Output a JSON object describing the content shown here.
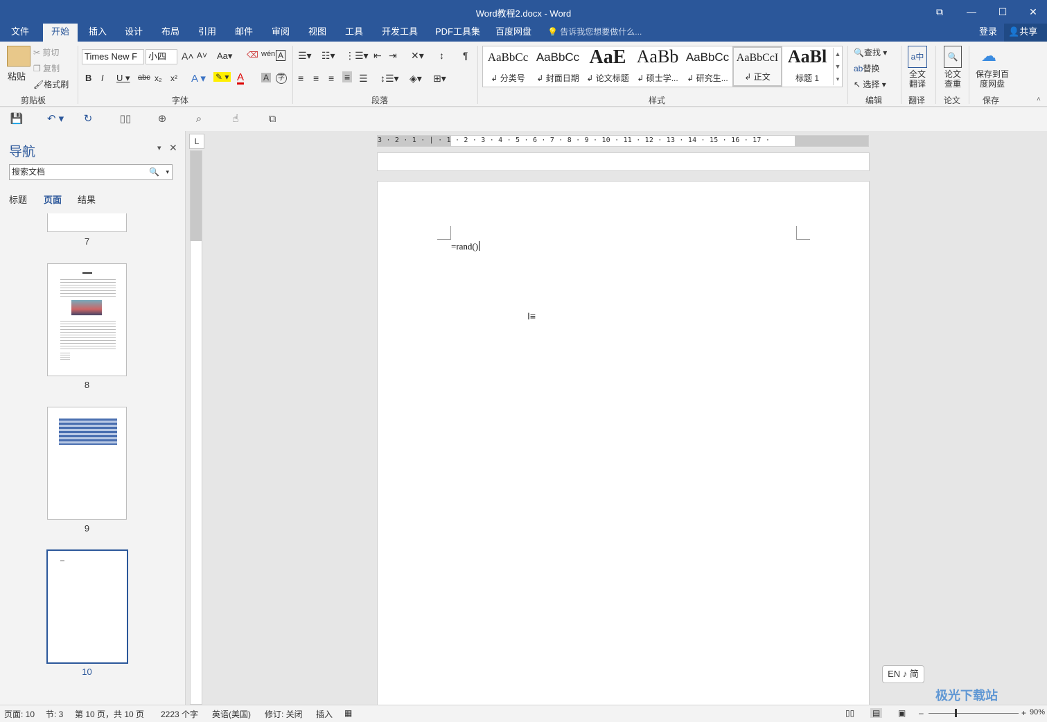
{
  "window": {
    "title": "Word教程2.docx - Word"
  },
  "tabs": [
    "文件",
    "开始",
    "插入",
    "设计",
    "布局",
    "引用",
    "邮件",
    "审阅",
    "视图",
    "工具",
    "开发工具",
    "PDF工具集",
    "百度网盘"
  ],
  "tell_me": "告诉我您想要做什么...",
  "account": {
    "login": "登录",
    "share": "共享"
  },
  "clipboard": {
    "paste": "粘贴",
    "cut": "剪切",
    "copy": "复制",
    "format_painter": "格式刷",
    "label": "剪贴板"
  },
  "font": {
    "name": "Times New F",
    "size": "小四",
    "label": "字体"
  },
  "paragraph": {
    "label": "段落"
  },
  "styles": {
    "label": "样式",
    "items": [
      {
        "preview": "AaBbCc",
        "name": "分类号"
      },
      {
        "preview": "AaBbCc",
        "name": "封面日期"
      },
      {
        "preview": "AaE",
        "name": "论文标题"
      },
      {
        "preview": "AaBb",
        "name": "硕士学..."
      },
      {
        "preview": "AaBbCc",
        "name": "研究生..."
      },
      {
        "preview": "AaBbCcI",
        "name": "正文"
      },
      {
        "preview": "AaBl",
        "name": "标题 1"
      }
    ]
  },
  "editing": {
    "find": "查找",
    "replace": "替换",
    "select": "选择",
    "label": "编辑"
  },
  "translate": {
    "full": "全文翻译",
    "label": "翻译"
  },
  "paper": {
    "check": "论文查重",
    "label": "论文"
  },
  "save": {
    "baidu": "保存到百度网盘",
    "label": "保存"
  },
  "navigation": {
    "title": "导航",
    "search_placeholder": "搜索文档",
    "tabs": [
      "标题",
      "页面",
      "结果"
    ],
    "active_tab": "页面",
    "pages": [
      "7",
      "8",
      "9",
      "10"
    ]
  },
  "ruler": {
    "marks": "3 · 2 · 1 · | · 1 · 2 · 3 · 4 · 5 · 6 · 7 · 8 · 9 · 10 · 11 · 12 · 13 · 14 · 15 · 16 · 17 ·"
  },
  "document": {
    "text": "=rand()"
  },
  "ime": "EN ♪ 简",
  "statusbar": {
    "page": "页面: 10",
    "section": "节: 3",
    "page_of": "第 10 页，共 10 页",
    "words": "2223 个字",
    "language": "英语(美国)",
    "track": "修订: 关闭",
    "mode": "插入",
    "zoom": "90%"
  },
  "watermark": "极光下载站"
}
